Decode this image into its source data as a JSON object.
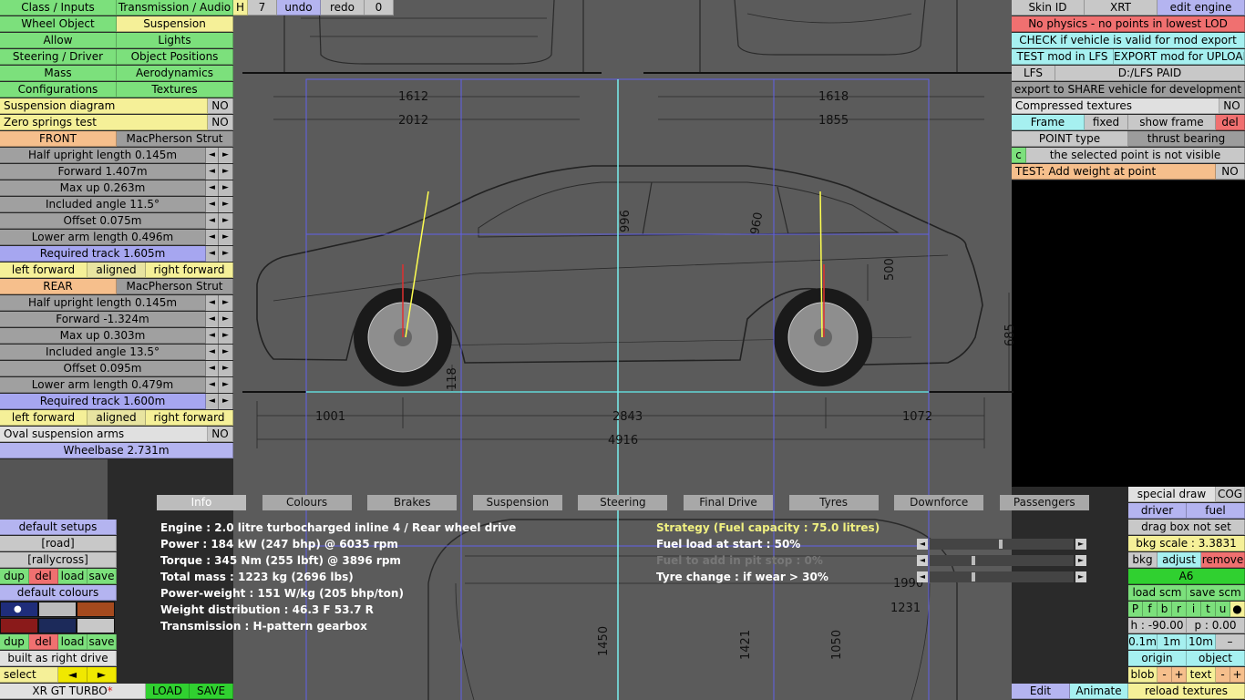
{
  "top_menu": {
    "class_inputs": "Class / Inputs",
    "transmission_audio": "Transmission / Audio",
    "h": "H",
    "seven": "7",
    "undo": "undo",
    "redo": "redo",
    "zero": "0"
  },
  "left_menu": {
    "wheel_object": "Wheel Object",
    "suspension": "Suspension",
    "allow": "Allow",
    "lights": "Lights",
    "steering_driver": "Steering / Driver",
    "object_positions": "Object Positions",
    "mass": "Mass",
    "aerodynamics": "Aerodynamics",
    "configurations": "Configurations",
    "textures": "Textures"
  },
  "suspension": {
    "diagram_label": "Suspension diagram",
    "diagram_value": "NO",
    "zero_springs_label": "Zero springs test",
    "zero_springs_value": "NO",
    "front_label": "FRONT",
    "front_type": "MacPherson Strut",
    "front_params": [
      "Half upright length 0.145m",
      "Forward 1.407m",
      "Max up 0.263m",
      "Included angle 11.5°",
      "Offset 0.075m",
      "Lower arm length 0.496m",
      "Required track 1.605m"
    ],
    "front_align": {
      "left": "left forward",
      "mid": "aligned",
      "right": "right forward"
    },
    "rear_label": "REAR",
    "rear_type": "MacPherson Strut",
    "rear_params": [
      "Half upright length 0.145m",
      "Forward -1.324m",
      "Max up 0.303m",
      "Included angle 13.5°",
      "Offset 0.095m",
      "Lower arm length 0.479m",
      "Required track 1.600m"
    ],
    "rear_align": {
      "left": "left forward",
      "mid": "aligned",
      "right": "right forward"
    },
    "oval_label": "Oval suspension arms",
    "oval_value": "NO",
    "wheelbase": "Wheelbase 2.731m"
  },
  "setups": {
    "default_setups": "default setups",
    "road": "[road]",
    "rallycross": "[rallycross]",
    "dup": "dup",
    "del": "del",
    "load": "load",
    "save": "save",
    "default_colours": "default colours",
    "dup2": "dup",
    "del2": "del",
    "load2": "load",
    "save2": "save",
    "built_as": "built as right drive",
    "select": "select",
    "prev": "◄",
    "next": "►"
  },
  "bottom_bar": {
    "vehicle": "XR GT TURBO",
    "asterisk": "*",
    "load": "LOAD",
    "save": "SAVE",
    "edit": "Edit",
    "animate": "Animate",
    "reload_textures": "reload textures"
  },
  "right_top": {
    "skin_id": "Skin ID",
    "xrt": "XRT",
    "edit_engine": "edit engine",
    "no_physics": "No physics - no points in lowest LOD",
    "check_valid": "CHECK if vehicle is valid for mod export",
    "test_mod": "TEST mod in LFS",
    "export_mod": "EXPORT mod for UPLOAD",
    "lfs": "LFS",
    "path": "D:/LFS PAID",
    "export_share": "export to SHARE vehicle for development",
    "compressed": "Compressed textures",
    "compressed_value": "NO",
    "frame": "Frame",
    "fixed": "fixed",
    "show_frame": "show frame",
    "del": "del",
    "point_type": "POINT type",
    "point_type_value": "thrust bearing",
    "c": "c",
    "not_visible": "the selected point is not visible",
    "add_weight": "TEST: Add weight at point",
    "add_weight_value": "NO"
  },
  "right_bottom": {
    "special_draw": "special draw",
    "cog": "COG",
    "driver": "driver",
    "fuel": "fuel",
    "drag_box": "drag box not set",
    "bkg_scale": "bkg scale : 3.3831",
    "bkg": "bkg",
    "adjust": "adjust",
    "remove": "remove",
    "a6": "A6",
    "load_scm": "load scm",
    "save_scm": "save scm",
    "letters": [
      "P",
      "f",
      "b",
      "r",
      "i",
      "t",
      "u",
      "●"
    ],
    "h_val": "h : -90.00",
    "p_val": "p : 0.00",
    "step1": "0.1m",
    "step2": "1m",
    "step3": "10m",
    "minus": "–",
    "origin": "origin",
    "object": "object",
    "blob": "blob",
    "text": "text",
    "pm_minus": "-",
    "pm_plus": "+"
  },
  "tabs": [
    "Info",
    "Colours",
    "Brakes",
    "Suspension",
    "Steering",
    "Final Drive",
    "Tyres",
    "Downforce",
    "Passengers"
  ],
  "info": {
    "engine": "Engine : 2.0 litre turbocharged inline 4 / Rear wheel drive",
    "power": "Power : 184 kW (247 bhp) @ 6035 rpm",
    "torque": "Torque : 345 Nm (255 lbft) @ 3896 rpm",
    "mass": "Total mass : 1223 kg (2696 lbs)",
    "pw": "Power-weight : 151 W/kg (205 bhp/ton)",
    "wd": "Weight distribution : 46.3 F  53.7 R",
    "trans": "Transmission : H-pattern gearbox",
    "strategy": "Strategy (Fuel capacity : 75.0 litres)",
    "fuel_load": "Fuel load at start : 50%",
    "refuel": "Fuel to add in pit stop : 0%",
    "tyre": "Tyre change : if wear > 30%"
  },
  "blueprint": {
    "dims": [
      "1612",
      "2012",
      "1618",
      "1855",
      "996",
      "960",
      "500",
      "685",
      "118",
      "1001",
      "2843",
      "1072",
      "4916",
      "1450",
      "1421",
      "1050",
      "1990",
      "1231"
    ]
  },
  "colors": {
    "swatches": [
      "#1f2d7a",
      "#bcbcbc",
      "#a54a1e",
      "#8a1a1a",
      "#1c2a5a",
      "#c8c8c8"
    ]
  }
}
